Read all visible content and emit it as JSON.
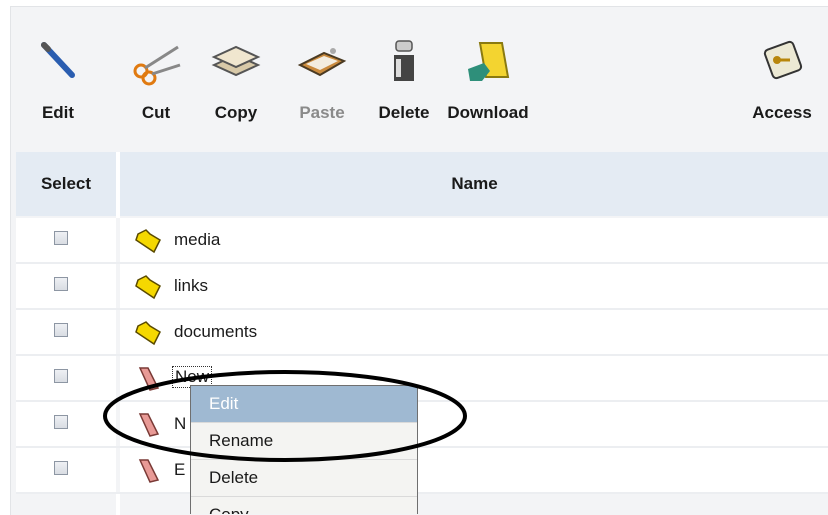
{
  "toolbar": {
    "items": [
      {
        "label": "Edit",
        "icon": "pencil-icon",
        "enabled": true
      },
      {
        "label": "Cut",
        "icon": "scissors-icon",
        "enabled": true
      },
      {
        "label": "Copy",
        "icon": "copy-icon",
        "enabled": true
      },
      {
        "label": "Paste",
        "icon": "clipboard-icon",
        "enabled": false
      },
      {
        "label": "Delete",
        "icon": "trash-can-icon",
        "enabled": true
      },
      {
        "label": "Download",
        "icon": "download-folder-icon",
        "enabled": true
      },
      {
        "label": "Access",
        "icon": "key-icon",
        "enabled": true
      }
    ]
  },
  "table": {
    "headers": {
      "select": "Select",
      "name": "Name"
    },
    "rows": [
      {
        "name": "media",
        "type": "folder",
        "icon": "folder-icon"
      },
      {
        "name": "links",
        "type": "folder",
        "icon": "folder-icon"
      },
      {
        "name": "documents",
        "type": "folder",
        "icon": "folder-icon"
      },
      {
        "name": "New",
        "type": "file",
        "icon": "page-icon",
        "selected": true
      },
      {
        "name": "N",
        "type": "file",
        "icon": "page-icon"
      },
      {
        "name": "E",
        "type": "file",
        "icon": "page-icon"
      }
    ]
  },
  "context_menu": {
    "items": [
      {
        "label": "Edit",
        "highlighted": true
      },
      {
        "label": "Rename"
      },
      {
        "label": "Delete"
      },
      {
        "label": "Copy"
      }
    ]
  },
  "colors": {
    "header_bg": "#e4ebf3",
    "menu_highlight": "#9fb9d2",
    "folder": "#f5d800",
    "page": "#e89a96",
    "annotation": "#000000"
  }
}
